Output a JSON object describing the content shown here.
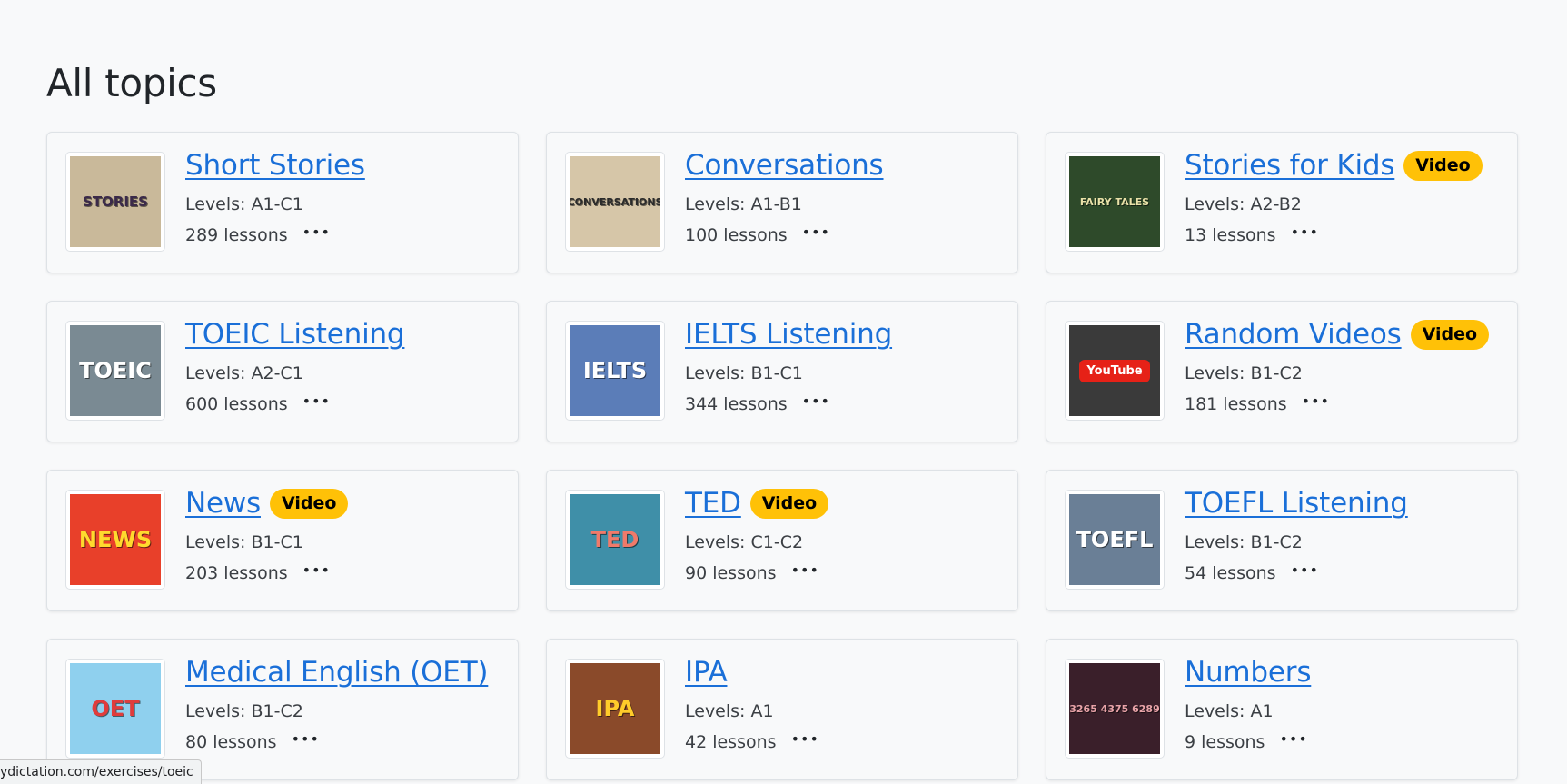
{
  "page": {
    "title": "All topics"
  },
  "topics": [
    {
      "title": "Short Stories",
      "levels": "Levels: A1-C1",
      "lessons": "289 lessons",
      "badge": "",
      "thumb_text": "STORIES",
      "thumb_bg": "#c9b99a",
      "thumb_fg": "#3b2a4a"
    },
    {
      "title": "Conversations",
      "levels": "Levels: A1-B1",
      "lessons": "100 lessons",
      "badge": "",
      "thumb_text": "CONVERSATIONS",
      "thumb_bg": "#d6c6a8",
      "thumb_fg": "#2b2b2b"
    },
    {
      "title": "Stories for Kids",
      "levels": "Levels: A2-B2",
      "lessons": "13 lessons",
      "badge": "Video",
      "thumb_text": "FAIRY TALES",
      "thumb_bg": "#2e4a2a",
      "thumb_fg": "#e9e1a8"
    },
    {
      "title": "TOEIC Listening",
      "levels": "Levels: A2-C1",
      "lessons": "600 lessons",
      "badge": "",
      "thumb_text": "TOEIC",
      "thumb_bg": "#7a8a93",
      "thumb_fg": "#ffffff"
    },
    {
      "title": "IELTS Listening",
      "levels": "Levels: B1-C1",
      "lessons": "344 lessons",
      "badge": "",
      "thumb_text": "IELTS",
      "thumb_bg": "#5b7db8",
      "thumb_fg": "#ffffff"
    },
    {
      "title": "Random Videos",
      "levels": "Levels: B1-C2",
      "lessons": "181 lessons",
      "badge": "Video",
      "thumb_text": "YouTube",
      "thumb_bg": "#3a3a3a",
      "thumb_fg": "#ffffff"
    },
    {
      "title": "News",
      "levels": "Levels: B1-C1",
      "lessons": "203 lessons",
      "badge": "Video",
      "thumb_text": "NEWS",
      "thumb_bg": "#e8402a",
      "thumb_fg": "#ffd92e"
    },
    {
      "title": "TED",
      "levels": "Levels: C1-C2",
      "lessons": "90 lessons",
      "badge": "Video",
      "thumb_text": "TED",
      "thumb_bg": "#3f8fa8",
      "thumb_fg": "#f07a6a"
    },
    {
      "title": "TOEFL Listening",
      "levels": "Levels: B1-C2",
      "lessons": "54 lessons",
      "badge": "",
      "thumb_text": "TOEFL",
      "thumb_bg": "#6a7f96",
      "thumb_fg": "#ffffff"
    },
    {
      "title": "Medical English (OET)",
      "levels": "Levels: B1-C2",
      "lessons": "80 lessons",
      "badge": "",
      "thumb_text": "OET",
      "thumb_bg": "#8fd0ee",
      "thumb_fg": "#e03c3c"
    },
    {
      "title": "IPA",
      "levels": "Levels: A1",
      "lessons": "42 lessons",
      "badge": "",
      "thumb_text": "IPA",
      "thumb_bg": "#8a4a2a",
      "thumb_fg": "#ffcc2a"
    },
    {
      "title": "Numbers",
      "levels": "Levels: A1",
      "lessons": "9 lessons",
      "badge": "",
      "thumb_text": "3265 4375 6289",
      "thumb_bg": "#3a1f2a",
      "thumb_fg": "#e8a3a8"
    }
  ],
  "status_bar": {
    "url": "ydictation.com/exercises/toeic"
  },
  "colors": {
    "link": "#1a6fd8",
    "badge": "#ffc107",
    "card_border": "#dee2e6",
    "background": "#f8f9fa"
  },
  "icons": {
    "more": "more-horizontal-icon"
  }
}
